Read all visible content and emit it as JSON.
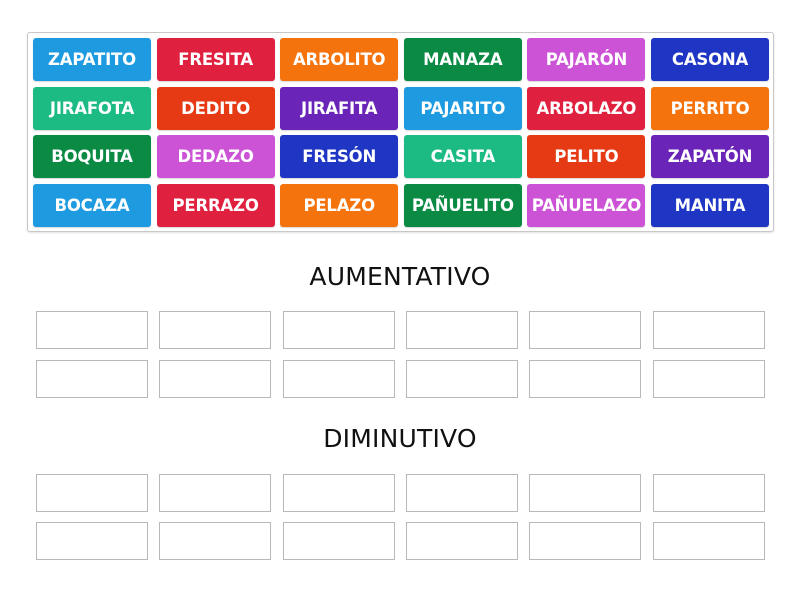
{
  "colors": {
    "blue": "#1e9be0",
    "red": "#e0203f",
    "orange": "#f5730c",
    "darkgreen": "#0a8a43",
    "magenta": "#cc52d6",
    "navy": "#1f36c4",
    "teal": "#1dbb84",
    "vermilion": "#e63a15",
    "purple": "#6a24b8"
  },
  "tiles": [
    {
      "label": "ZAPATITO",
      "color": "#1e9be0"
    },
    {
      "label": "FRESITA",
      "color": "#e0203f"
    },
    {
      "label": "ARBOLITO",
      "color": "#f5730c"
    },
    {
      "label": "MANAZA",
      "color": "#0a8a43"
    },
    {
      "label": "PAJARÓN",
      "color": "#cc52d6"
    },
    {
      "label": "CASONA",
      "color": "#1f36c4"
    },
    {
      "label": "JIRAFOTA",
      "color": "#1dbb84"
    },
    {
      "label": "DEDITO",
      "color": "#e63a15"
    },
    {
      "label": "JIRAFITA",
      "color": "#6a24b8"
    },
    {
      "label": "PAJARITO",
      "color": "#1e9be0"
    },
    {
      "label": "ARBOLAZO",
      "color": "#e0203f"
    },
    {
      "label": "PERRITO",
      "color": "#f5730c"
    },
    {
      "label": "BOQUITA",
      "color": "#0a8a43"
    },
    {
      "label": "DEDAZO",
      "color": "#cc52d6"
    },
    {
      "label": "FRESÓN",
      "color": "#1f36c4"
    },
    {
      "label": "CASITA",
      "color": "#1dbb84"
    },
    {
      "label": "PELITO",
      "color": "#e63a15"
    },
    {
      "label": "ZAPATÓN",
      "color": "#6a24b8"
    },
    {
      "label": "BOCAZA",
      "color": "#1e9be0"
    },
    {
      "label": "PERRAZO",
      "color": "#e0203f"
    },
    {
      "label": "PELAZO",
      "color": "#f5730c"
    },
    {
      "label": "PAÑUELITO",
      "color": "#0a8a43"
    },
    {
      "label": "PAÑUELAZO",
      "color": "#cc52d6"
    },
    {
      "label": "MANITA",
      "color": "#1f36c4"
    }
  ],
  "groups": [
    {
      "title": "AUMENTATIVO",
      "slots": 12
    },
    {
      "title": "DIMINUTIVO",
      "slots": 12
    }
  ]
}
